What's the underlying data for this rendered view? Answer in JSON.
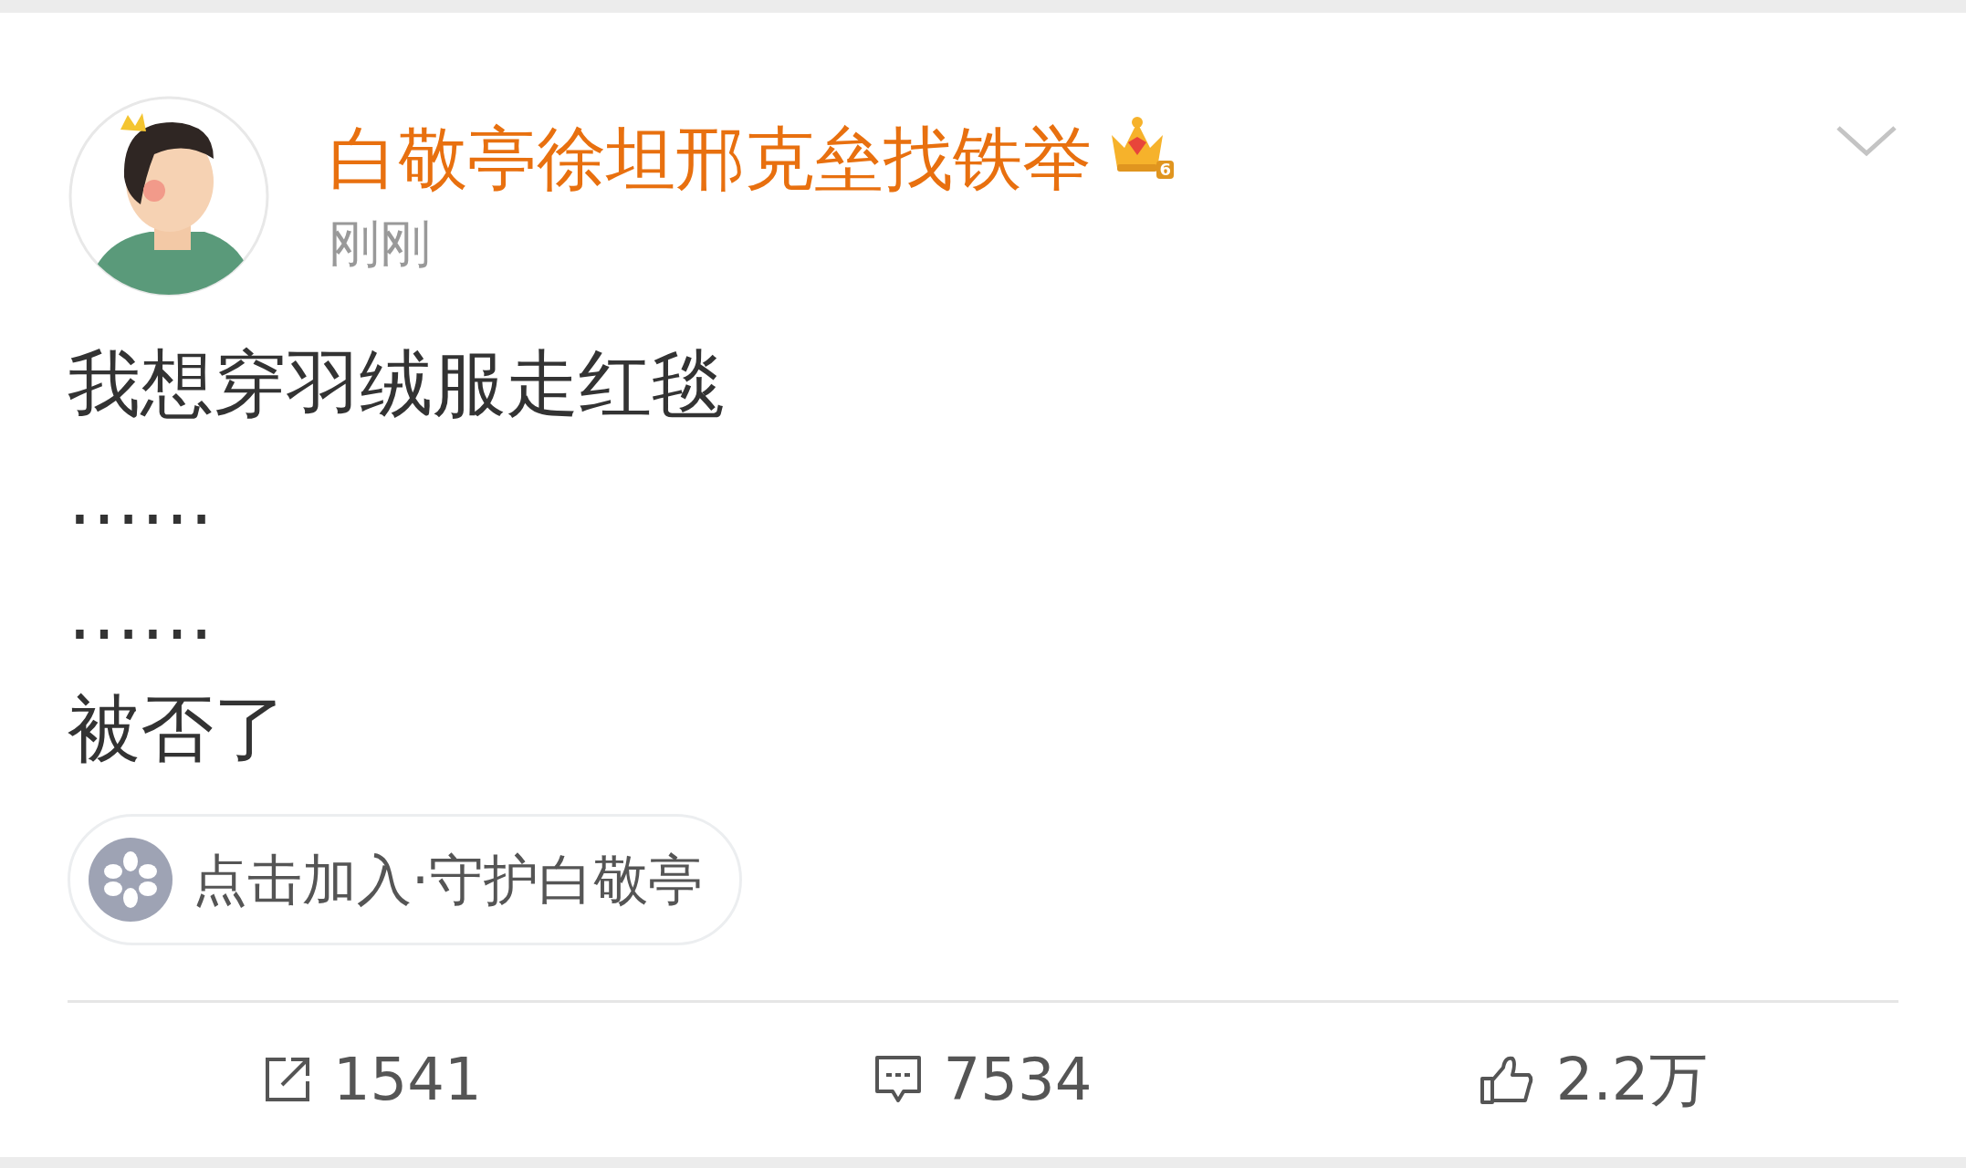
{
  "post": {
    "author": {
      "name": "白敬亭徐坦邢克垒找铁举",
      "vip_level": "6"
    },
    "time": "刚刚",
    "lines": [
      "我想穿羽绒服走红毯",
      "……",
      "……",
      "被否了"
    ],
    "supertopic": {
      "label": "点击加入·守护白敬亭"
    }
  },
  "actions": [
    {
      "kind": "repost",
      "count": "1541"
    },
    {
      "kind": "comment",
      "count": "7534"
    },
    {
      "kind": "like",
      "count": "2.2万"
    }
  ]
}
